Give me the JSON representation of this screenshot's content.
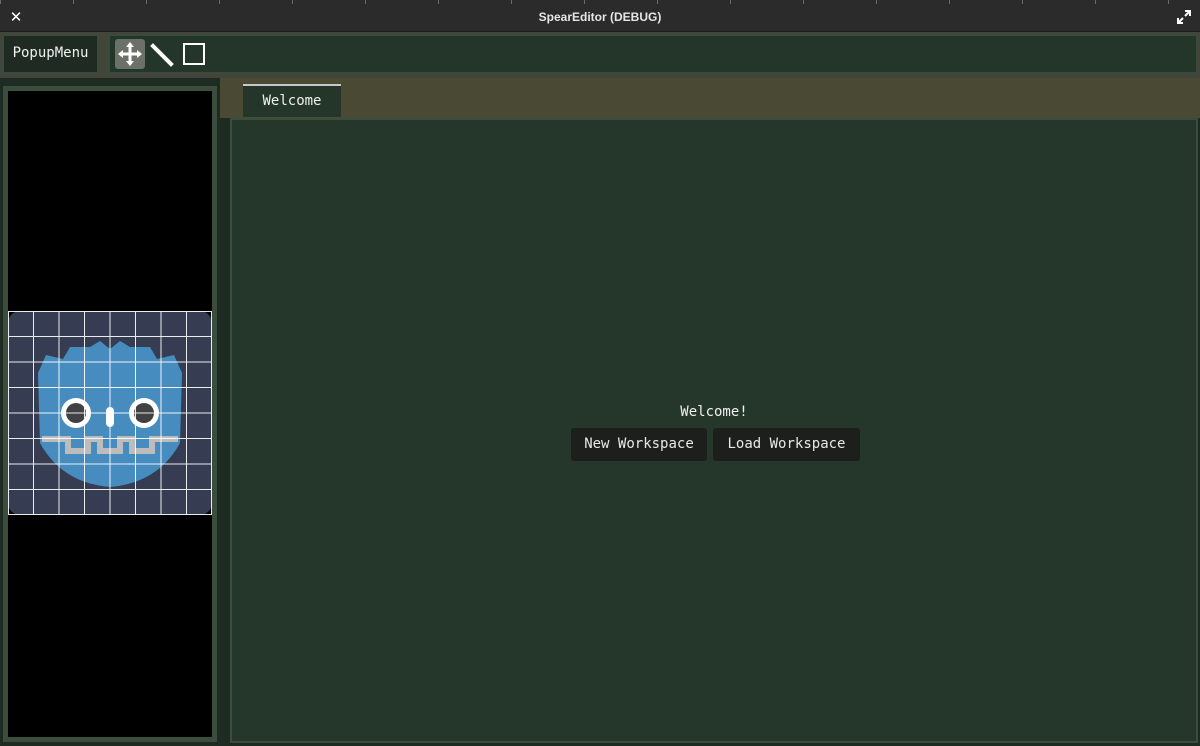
{
  "window": {
    "title": "SpearEditor (DEBUG)",
    "close_glyph": "✕",
    "close_icon": "close-icon",
    "maximize_icon": "maximize-icon"
  },
  "toolbar": {
    "popup_menu_label": "PopupMenu",
    "tools": [
      {
        "name": "move-tool",
        "icon": "move-arrows-icon",
        "active": true
      },
      {
        "name": "line-tool",
        "icon": "line-icon",
        "active": false
      },
      {
        "name": "rect-tool",
        "icon": "rectangle-icon",
        "active": false
      }
    ]
  },
  "preview": {
    "image": "godot-logo-icon",
    "grid": true
  },
  "tabs": [
    {
      "label": "Welcome",
      "active": true
    }
  ],
  "welcome": {
    "heading": "Welcome!",
    "new_workspace_label": "New Workspace",
    "load_workspace_label": "Load Workspace"
  },
  "colors": {
    "panel_green": "#25372a",
    "tabbar_olive": "#4a4933",
    "toolbar_olive": "#43453a",
    "button_dark": "#1c1f1c",
    "logo_blue": "#478cbf"
  }
}
